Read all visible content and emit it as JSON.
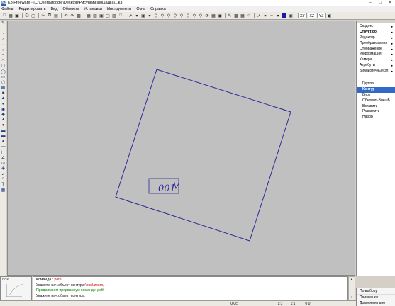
{
  "window": {
    "title": "K3 Freeware - [C:\\Users\\google\\Desktop\\Рисунки\\Площадка\\1.k3]",
    "app_icon_text": "K3",
    "controls": [
      "minimize",
      "maximize",
      "close"
    ]
  },
  "menubar": {
    "items": [
      "Файлы",
      "Редактировать",
      "Вид",
      "Объекты",
      "Установки",
      "Инструменты",
      "Окна",
      "Справка"
    ]
  },
  "toolbar": {
    "zoom_labels": [
      "ХУ",
      "ХZ",
      "YZ"
    ]
  },
  "canvas": {
    "background": "#c0c0c0",
    "stroke_color": "#2a2a9a",
    "label_text": "001"
  },
  "right_panel": {
    "menu_items": [
      {
        "label": "Создать",
        "arrow": true,
        "bold": false
      },
      {
        "label": "Структ.об.",
        "arrow": true,
        "bold": true
      },
      {
        "label": "Редактир.",
        "arrow": true,
        "bold": false
      },
      {
        "label": "Преобразования",
        "arrow": true,
        "bold": false
      },
      {
        "label": "Отображение",
        "arrow": true,
        "bold": false
      },
      {
        "label": "Информация",
        "arrow": true,
        "bold": false
      },
      {
        "label": "Камера",
        "arrow": true,
        "bold": false
      },
      {
        "label": "Атрибуты",
        "arrow": true,
        "bold": false
      },
      {
        "label": "Библиотечный эл.",
        "arrow": true,
        "bold": false
      }
    ],
    "submenu_items": [
      {
        "label": "Группа",
        "selected": false
      },
      {
        "label": "Контур",
        "selected": true
      },
      {
        "label": "Блок",
        "selected": false
      },
      {
        "label": "ОбновитьВнешБ...",
        "selected": false
      },
      {
        "label": "Вставить",
        "selected": false
      },
      {
        "label": "Развалить",
        "selected": false
      },
      {
        "label": "Набор",
        "selected": false
      }
    ]
  },
  "console": {
    "lines": [
      {
        "prefix": "Команда : ",
        "text": "path",
        "color": "red"
      },
      {
        "prefix": "Укажите нач.объект контура:",
        "text": "\\pxxl.zoom,",
        "color": "red"
      },
      {
        "prefix": "",
        "text": "Продолжаем прерванную команду: path",
        "color": "green"
      },
      {
        "prefix": "",
        "text": "Укажите нач.объект контура:",
        "color": "black"
      }
    ],
    "thumb_label": "ПСК"
  },
  "right_bottom": {
    "items": [
      "По выбору",
      "Положение",
      "Дополнительно"
    ]
  },
  "statusbar": {
    "angle": "0.0с",
    "scale1": "1:1",
    "scale2": "1:1",
    "coords": "0  0"
  }
}
